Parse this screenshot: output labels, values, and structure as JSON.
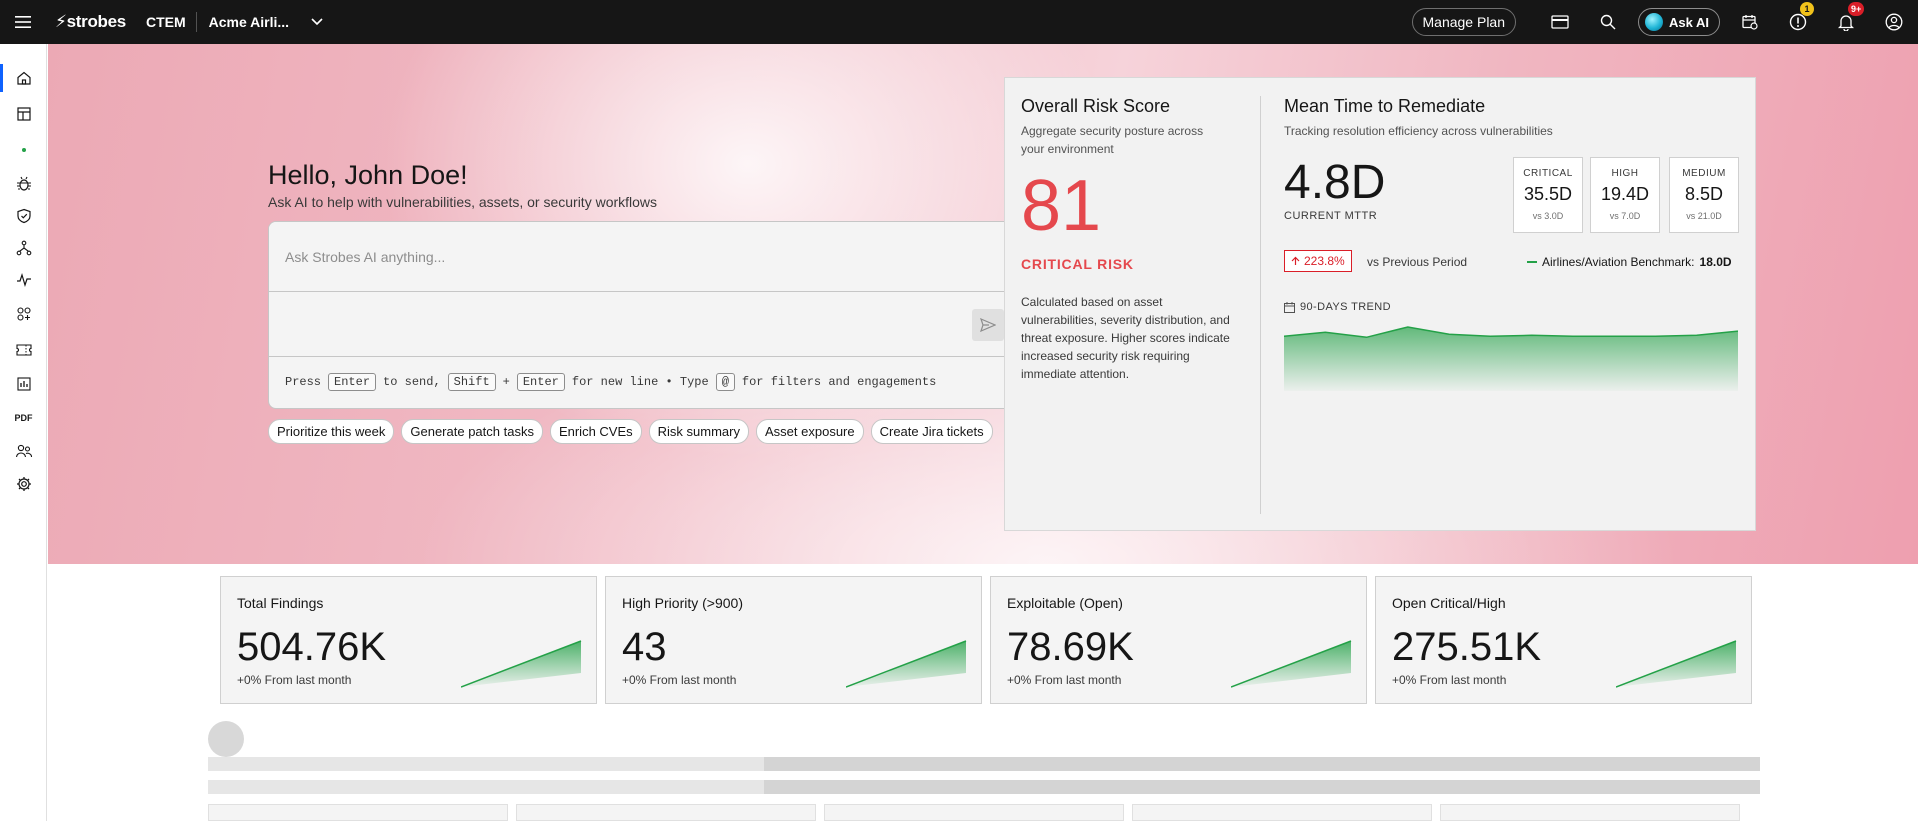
{
  "header": {
    "brand": "strobes",
    "product": "CTEM",
    "org": "Acme Airli...",
    "manage_plan": "Manage Plan",
    "ask_ai": "Ask AI",
    "alert_badge": "1",
    "notif_badge": "9+"
  },
  "sidebar": {
    "items": [
      "home-icon",
      "dashboard-icon",
      "dot-icon",
      "bug-icon",
      "shield-check-icon",
      "network-icon",
      "activity-icon",
      "integrations-icon",
      "ticket-icon",
      "report-icon",
      "pdf-icon",
      "users-icon",
      "settings-icon"
    ],
    "pdf_label": "PDF"
  },
  "hero": {
    "greeting": "Hello, John Doe!",
    "subtitle": "Ask AI to help with vulnerabilities, assets, or security workflows",
    "placeholder": "Ask Strobes AI anything...",
    "hint": {
      "press": "Press",
      "enter": "Enter",
      "to_send": "to send,",
      "shift": "Shift",
      "plus": "+",
      "for_new_line": "for new line • Type",
      "at": "@",
      "for_filters": "for filters and engagements"
    },
    "chips": [
      "Prioritize this week",
      "Generate patch tasks",
      "Enrich CVEs",
      "Risk summary",
      "Asset exposure",
      "Create Jira tickets"
    ]
  },
  "risk": {
    "title": "Overall Risk Score",
    "subtitle_line1": "Aggregate security posture across",
    "subtitle_line2": "your environment",
    "score": "81",
    "level": "CRITICAL RISK",
    "description": "Calculated based on asset vulnerabilities, severity distribution, and threat exposure. Higher scores indicate increased security risk requiring immediate attention."
  },
  "mttr": {
    "title": "Mean Time to Remediate",
    "subtitle": "Tracking resolution efficiency across vulnerabilities",
    "value": "4.8D",
    "label": "CURRENT MTTR",
    "severities": [
      {
        "name": "CRITICAL",
        "value": "35.5D",
        "vs": "vs 3.0D"
      },
      {
        "name": "HIGH",
        "value": "19.4D",
        "vs": "vs 7.0D"
      },
      {
        "name": "MEDIUM",
        "value": "8.5D",
        "vs": "vs 21.0D"
      }
    ],
    "delta": "223.8%",
    "vs_previous": "vs Previous Period",
    "benchmark_label": "Airlines/Aviation Benchmark:",
    "benchmark_value": "18.0D",
    "trend_label": "90-DAYS TREND",
    "trend_values": [
      22,
      26,
      21,
      31,
      24,
      22,
      23,
      22,
      22,
      22,
      23,
      27
    ],
    "accent": "#24a148"
  },
  "stats": [
    {
      "title": "Total Findings",
      "value": "504.76K",
      "delta": "+0% From last month"
    },
    {
      "title": "High Priority (>900)",
      "value": "43",
      "delta": "+0% From last month"
    },
    {
      "title": "Exploitable (Open)",
      "value": "78.69K",
      "delta": "+0% From last month"
    },
    {
      "title": "Open Critical/High",
      "value": "275.51K",
      "delta": "+0% From last month"
    }
  ],
  "colors": {
    "critical": "#e5484d",
    "topbar": "#161616",
    "active_nav": "#0f62fe"
  }
}
